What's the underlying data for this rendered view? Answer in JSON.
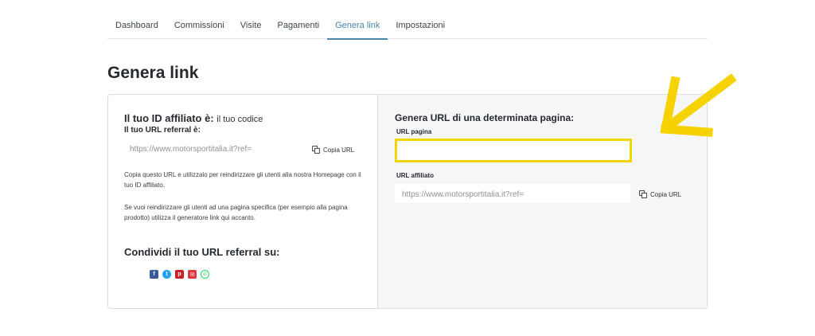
{
  "tabs": [
    {
      "label": "Dashboard",
      "active": false
    },
    {
      "label": "Commissioni",
      "active": false
    },
    {
      "label": "Visite",
      "active": false
    },
    {
      "label": "Pagamenti",
      "active": false
    },
    {
      "label": "Genera link",
      "active": true
    },
    {
      "label": "Impostazioni",
      "active": false
    }
  ],
  "page_title": "Genera link",
  "left": {
    "id_label": "Il tuo ID affiliato è:",
    "id_value": "il tuo codice",
    "referral_label": "Il tuo URL referral è:",
    "referral_url": "https://www.motorsportitalia.it?ref=",
    "copy_label": "Copia URL",
    "paragraph1": "Copia questo URL e utilizzalo per reindirizzare gli utenti alla nostra Homepage con il tuo ID affiliato.",
    "paragraph2": "Se vuoi reindirizzare gli utenti ad una pagina specifica (per esempio alla pagina prodotto) utilizza il generatore link qui accanto.",
    "share_title": "Condividi il tuo URL referral su:",
    "social_icons": [
      "facebook-icon",
      "twitter-icon",
      "pinterest-icon",
      "email-icon",
      "whatsapp-icon"
    ]
  },
  "right": {
    "title": "Genera URL di una determinata pagina:",
    "page_url_label": "URL pagina",
    "page_url_value": "",
    "affiliate_url_label": "URL affiliato",
    "affiliate_url": "https://www.motorsportitalia.it?ref=",
    "copy_label": "Copia URL"
  },
  "colors": {
    "accent": "#4b86a8",
    "highlight": "#f1d400"
  }
}
